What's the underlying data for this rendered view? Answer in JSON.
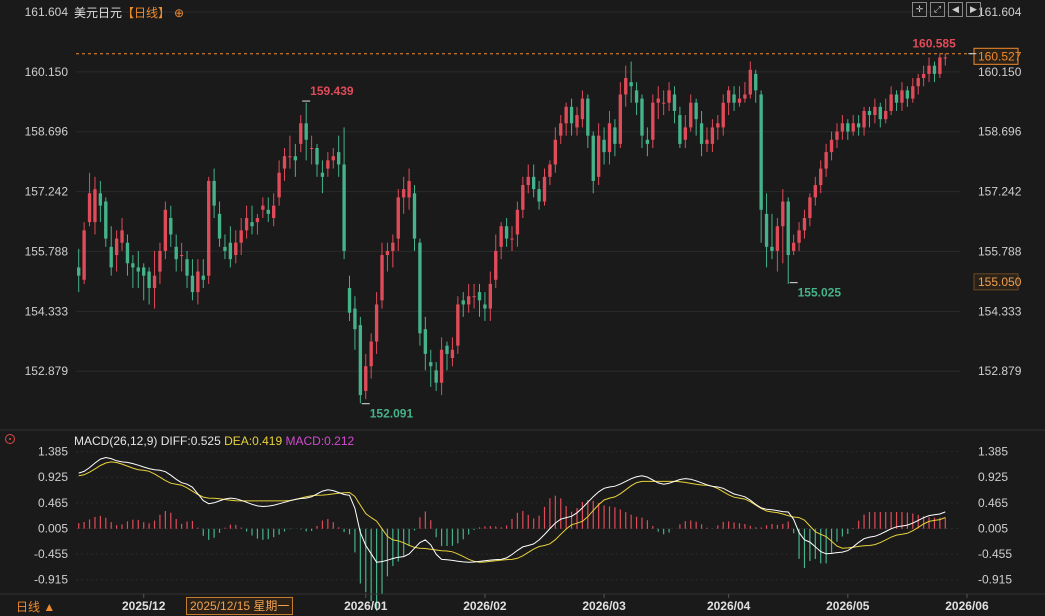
{
  "header": {
    "symbol": "美元日元",
    "timeframe": "【日线】",
    "add_icon": "plus-circle-icon",
    "tool_icons": [
      "crosshair-icon",
      "expand-icon",
      "prev-icon",
      "next-icon"
    ]
  },
  "macd_header": {
    "name": "MACD(26,12,9)",
    "diff": "DIFF:0.525",
    "dea": "DEA:0.419",
    "macd": "MACD:0.212"
  },
  "footer": {
    "period_label": "日线 ▲",
    "crosshair_date": "2025/12/15 星期一"
  },
  "colors": {
    "background": "#1a1a1a",
    "up": "#e04b5a",
    "down": "#45b28a",
    "dea": "#e8d23a",
    "diff": "#ffffff",
    "current_price": "#f08a2c"
  },
  "chart_data": [
    {
      "type": "candlestick",
      "ylim": [
        151.5,
        161.7
      ],
      "yticks": [
        "161.604",
        "160.150",
        "158.696",
        "157.242",
        "155.788",
        "154.333",
        "152.879"
      ],
      "xticks": [
        {
          "label": "2025/12",
          "index": 12
        },
        {
          "label": "2026/01",
          "index": 53
        },
        {
          "label": "2026/02",
          "index": 75
        },
        {
          "label": "2026/03",
          "index": 97
        },
        {
          "label": "2026/04",
          "index": 120
        },
        {
          "label": "2026/05",
          "index": 142
        },
        {
          "label": "2026/06",
          "index": 164
        }
      ],
      "annotations": [
        {
          "label": "159.439",
          "index": 42,
          "value": 159.44,
          "kind": "high"
        },
        {
          "label": "152.091",
          "index": 53,
          "value": 152.09,
          "kind": "low"
        },
        {
          "label": "155.025",
          "index": 132,
          "value": 155.03,
          "kind": "low"
        },
        {
          "label": "160.585",
          "index": 165,
          "value": 160.59,
          "kind": "high"
        }
      ],
      "current_price": {
        "label": "160.527",
        "value": 160.527
      },
      "crosshair_price": {
        "label": "155.050",
        "value": 155.05
      },
      "candles": [
        [
          155.4,
          155.2,
          155.85,
          154.8
        ],
        [
          155.1,
          156.3,
          156.5,
          155.0
        ],
        [
          156.5,
          157.2,
          157.7,
          156.4
        ],
        [
          156.5,
          157.3,
          157.6,
          156.2
        ],
        [
          157.2,
          156.9,
          157.5,
          156.5
        ],
        [
          157.0,
          156.1,
          157.1,
          155.9
        ],
        [
          155.9,
          155.4,
          156.4,
          155.2
        ],
        [
          155.7,
          156.1,
          156.3,
          155.3
        ],
        [
          156.0,
          156.3,
          156.6,
          155.8
        ],
        [
          156.0,
          155.5,
          156.2,
          155.2
        ],
        [
          155.5,
          155.4,
          155.7,
          154.9
        ],
        [
          155.4,
          155.3,
          155.8,
          154.9
        ],
        [
          155.4,
          155.2,
          155.5,
          154.6
        ],
        [
          155.3,
          154.9,
          155.4,
          154.5
        ],
        [
          154.9,
          155.2,
          155.8,
          154.4
        ],
        [
          155.3,
          155.8,
          156.0,
          155.0
        ],
        [
          155.8,
          156.8,
          157.0,
          155.6
        ],
        [
          156.6,
          156.2,
          156.9,
          155.9
        ],
        [
          155.9,
          155.6,
          156.2,
          155.3
        ],
        [
          155.7,
          155.7,
          156.0,
          155.3
        ],
        [
          155.6,
          155.2,
          155.8,
          154.9
        ],
        [
          155.2,
          154.8,
          155.6,
          154.6
        ],
        [
          154.8,
          155.3,
          155.6,
          154.5
        ],
        [
          155.2,
          155.1,
          155.6,
          154.9
        ],
        [
          155.2,
          157.5,
          157.6,
          155.0
        ],
        [
          157.5,
          156.9,
          157.8,
          156.6
        ],
        [
          156.7,
          156.1,
          157.0,
          155.9
        ],
        [
          155.9,
          155.8,
          156.2,
          155.6
        ],
        [
          156.0,
          155.6,
          156.4,
          155.4
        ],
        [
          155.7,
          156.0,
          156.3,
          155.5
        ],
        [
          156.0,
          156.3,
          156.6,
          155.7
        ],
        [
          156.3,
          156.6,
          156.9,
          156.1
        ],
        [
          156.5,
          156.4,
          156.9,
          156.2
        ],
        [
          156.5,
          156.6,
          156.7,
          156.2
        ],
        [
          156.8,
          156.9,
          157.1,
          156.6
        ],
        [
          156.8,
          156.7,
          157.1,
          156.5
        ],
        [
          156.6,
          156.9,
          157.2,
          156.4
        ],
        [
          157.1,
          157.7,
          158.0,
          156.9
        ],
        [
          157.8,
          158.1,
          158.3,
          157.5
        ],
        [
          158.1,
          158.1,
          158.6,
          157.8
        ],
        [
          158.1,
          158.0,
          158.4,
          157.6
        ],
        [
          158.4,
          158.9,
          159.1,
          158.2
        ],
        [
          158.9,
          158.5,
          159.4,
          158.0
        ],
        [
          158.3,
          158.3,
          158.6,
          157.9
        ],
        [
          158.3,
          157.9,
          158.4,
          157.6
        ],
        [
          157.7,
          157.6,
          158.0,
          157.2
        ],
        [
          157.8,
          158.0,
          158.2,
          157.6
        ],
        [
          158.0,
          158.1,
          158.3,
          157.8
        ],
        [
          158.2,
          157.9,
          158.6,
          157.6
        ],
        [
          157.9,
          155.8,
          158.8,
          155.6
        ],
        [
          154.9,
          154.3,
          155.2,
          154.1
        ],
        [
          154.4,
          153.9,
          154.7,
          153.4
        ],
        [
          154.0,
          152.3,
          154.2,
          152.1
        ],
        [
          152.4,
          153.0,
          153.3,
          152.2
        ],
        [
          153.0,
          153.6,
          153.8,
          152.7
        ],
        [
          153.6,
          154.5,
          154.8,
          153.3
        ],
        [
          154.6,
          155.7,
          156.0,
          154.4
        ],
        [
          155.7,
          155.8,
          156.0,
          155.3
        ],
        [
          155.8,
          156.0,
          156.2,
          155.4
        ],
        [
          156.1,
          157.1,
          157.3,
          155.8
        ],
        [
          157.1,
          157.3,
          157.6,
          156.7
        ],
        [
          157.1,
          157.5,
          157.8,
          156.8
        ],
        [
          157.2,
          156.1,
          157.4,
          155.8
        ],
        [
          156.0,
          153.8,
          156.1,
          153.5
        ],
        [
          153.9,
          153.3,
          154.2,
          152.9
        ],
        [
          153.1,
          153.0,
          153.4,
          152.5
        ],
        [
          152.9,
          152.6,
          153.1,
          152.4
        ],
        [
          152.6,
          153.4,
          153.7,
          152.3
        ],
        [
          153.5,
          153.3,
          153.6,
          152.9
        ],
        [
          153.2,
          153.4,
          153.7,
          153.0
        ],
        [
          153.5,
          154.5,
          154.7,
          153.3
        ],
        [
          154.6,
          154.5,
          154.8,
          154.2
        ],
        [
          154.5,
          154.7,
          155.0,
          154.3
        ],
        [
          154.7,
          154.7,
          155.0,
          154.4
        ],
        [
          154.8,
          154.6,
          155.0,
          154.2
        ],
        [
          154.5,
          154.4,
          154.8,
          154.1
        ],
        [
          154.4,
          155.0,
          155.3,
          154.1
        ],
        [
          155.1,
          155.8,
          156.2,
          154.9
        ],
        [
          155.9,
          156.4,
          156.5,
          155.6
        ],
        [
          156.4,
          156.1,
          156.6,
          155.9
        ],
        [
          156.1,
          156.1,
          156.4,
          155.8
        ],
        [
          156.2,
          156.8,
          157.0,
          155.9
        ],
        [
          156.8,
          157.4,
          157.6,
          156.6
        ],
        [
          157.4,
          157.6,
          157.9,
          157.2
        ],
        [
          157.6,
          157.3,
          157.9,
          157.1
        ],
        [
          157.3,
          157.0,
          157.5,
          156.8
        ],
        [
          157.0,
          157.6,
          157.8,
          156.9
        ],
        [
          157.6,
          157.9,
          158.0,
          157.4
        ],
        [
          157.9,
          158.5,
          158.8,
          157.7
        ],
        [
          158.6,
          158.9,
          159.1,
          158.4
        ],
        [
          158.9,
          159.3,
          159.4,
          158.6
        ],
        [
          159.3,
          158.9,
          159.5,
          158.6
        ],
        [
          158.8,
          159.1,
          159.3,
          158.6
        ],
        [
          159.0,
          159.5,
          159.7,
          158.8
        ],
        [
          159.5,
          158.6,
          159.6,
          158.3
        ],
        [
          158.6,
          157.5,
          158.7,
          157.2
        ],
        [
          157.6,
          158.6,
          158.9,
          157.4
        ],
        [
          158.5,
          158.2,
          158.8,
          157.9
        ],
        [
          158.2,
          158.9,
          159.2,
          157.9
        ],
        [
          158.8,
          158.4,
          159.0,
          158.1
        ],
        [
          158.4,
          159.6,
          159.9,
          158.3
        ],
        [
          159.6,
          160.0,
          160.3,
          159.3
        ],
        [
          159.9,
          159.8,
          160.4,
          159.4
        ],
        [
          159.7,
          159.4,
          159.9,
          159.1
        ],
        [
          159.5,
          158.6,
          159.6,
          158.3
        ],
        [
          158.5,
          158.4,
          158.8,
          158.1
        ],
        [
          158.5,
          159.4,
          159.6,
          158.3
        ],
        [
          159.4,
          159.5,
          159.8,
          159.0
        ],
        [
          159.4,
          159.4,
          159.7,
          159.1
        ],
        [
          159.4,
          159.7,
          159.9,
          159.2
        ],
        [
          159.6,
          159.2,
          159.8,
          158.9
        ],
        [
          159.1,
          158.4,
          159.3,
          158.3
        ],
        [
          158.5,
          158.8,
          159.1,
          158.3
        ],
        [
          158.8,
          159.4,
          159.6,
          158.7
        ],
        [
          159.4,
          159.0,
          159.5,
          158.6
        ],
        [
          158.9,
          158.4,
          159.2,
          158.1
        ],
        [
          158.4,
          158.5,
          158.8,
          158.2
        ],
        [
          158.4,
          158.8,
          159.0,
          158.2
        ],
        [
          158.8,
          158.9,
          159.1,
          158.5
        ],
        [
          158.8,
          159.4,
          159.6,
          158.6
        ],
        [
          159.4,
          159.7,
          159.8,
          159.1
        ],
        [
          159.6,
          159.4,
          159.8,
          159.2
        ],
        [
          159.4,
          159.5,
          159.8,
          159.3
        ],
        [
          159.5,
          159.6,
          159.9,
          159.4
        ],
        [
          159.6,
          160.2,
          160.4,
          159.5
        ],
        [
          160.1,
          159.7,
          160.2,
          159.4
        ],
        [
          159.6,
          156.8,
          159.7,
          156.0
        ],
        [
          156.7,
          155.9,
          157.2,
          155.4
        ],
        [
          155.9,
          155.8,
          156.7,
          155.6
        ],
        [
          155.8,
          156.4,
          156.6,
          155.3
        ],
        [
          156.4,
          157.0,
          157.3,
          155.5
        ],
        [
          157.0,
          155.7,
          157.1,
          155.0
        ],
        [
          155.8,
          156.0,
          156.2,
          155.7
        ],
        [
          156.0,
          156.3,
          156.5,
          155.8
        ],
        [
          156.3,
          156.6,
          156.8,
          156.1
        ],
        [
          156.6,
          157.1,
          157.2,
          156.4
        ],
        [
          157.1,
          157.4,
          157.6,
          156.9
        ],
        [
          157.4,
          157.8,
          158.0,
          157.2
        ],
        [
          157.8,
          158.2,
          158.4,
          157.6
        ],
        [
          158.2,
          158.5,
          158.7,
          158.0
        ],
        [
          158.5,
          158.7,
          158.9,
          158.3
        ],
        [
          158.7,
          158.9,
          159.1,
          158.5
        ],
        [
          158.9,
          158.7,
          159.0,
          158.5
        ],
        [
          158.7,
          158.9,
          159.1,
          158.6
        ],
        [
          158.9,
          158.8,
          159.1,
          158.6
        ],
        [
          158.8,
          159.2,
          159.3,
          158.6
        ],
        [
          159.2,
          159.1,
          159.3,
          158.8
        ],
        [
          159.1,
          159.3,
          159.5,
          158.9
        ],
        [
          159.3,
          159.0,
          159.4,
          158.8
        ],
        [
          159.0,
          159.2,
          159.5,
          158.9
        ],
        [
          159.2,
          159.6,
          159.8,
          159.1
        ],
        [
          159.6,
          159.4,
          159.7,
          159.2
        ],
        [
          159.4,
          159.7,
          159.9,
          159.2
        ],
        [
          159.7,
          159.5,
          159.8,
          159.3
        ],
        [
          159.5,
          159.8,
          160.0,
          159.4
        ],
        [
          159.8,
          160.0,
          160.1,
          159.6
        ],
        [
          160.0,
          160.1,
          160.3,
          159.8
        ],
        [
          160.1,
          160.3,
          160.5,
          159.9
        ],
        [
          160.3,
          160.1,
          160.4,
          159.9
        ],
        [
          160.1,
          160.5,
          160.6,
          160.0
        ],
        [
          160.5,
          160.5,
          160.6,
          160.3
        ]
      ]
    },
    {
      "type": "macd",
      "params": "MACD(26,12,9)",
      "ylim": [
        -1.1,
        1.45
      ],
      "yticks": [
        "1.385",
        "0.925",
        "0.465",
        "0.005",
        "-0.455",
        "-0.915"
      ],
      "diff_anchors": [
        [
          0,
          1.0
        ],
        [
          5,
          1.28
        ],
        [
          8,
          1.2
        ],
        [
          15,
          1.05
        ],
        [
          20,
          0.8
        ],
        [
          24,
          0.45
        ],
        [
          28,
          0.55
        ],
        [
          34,
          0.4
        ],
        [
          42,
          0.55
        ],
        [
          46,
          0.7
        ],
        [
          50,
          0.6
        ],
        [
          53,
          -0.3
        ],
        [
          55,
          -0.6
        ],
        [
          60,
          -0.5
        ],
        [
          64,
          -0.2
        ],
        [
          67,
          -0.55
        ],
        [
          72,
          -0.6
        ],
        [
          78,
          -0.55
        ],
        [
          83,
          -0.3
        ],
        [
          90,
          0.2
        ],
        [
          98,
          0.75
        ],
        [
          104,
          0.95
        ],
        [
          108,
          0.8
        ],
        [
          112,
          0.9
        ],
        [
          118,
          0.75
        ],
        [
          122,
          0.6
        ],
        [
          127,
          0.35
        ],
        [
          131,
          0.3
        ],
        [
          134,
          -0.2
        ],
        [
          138,
          -0.45
        ],
        [
          141,
          -0.42
        ],
        [
          146,
          -0.15
        ],
        [
          152,
          0.05
        ],
        [
          158,
          0.25
        ],
        [
          164,
          0.45
        ],
        [
          168,
          0.525
        ]
      ],
      "dea_anchors": [
        [
          0,
          0.95
        ],
        [
          6,
          1.2
        ],
        [
          12,
          1.05
        ],
        [
          18,
          0.8
        ],
        [
          24,
          0.55
        ],
        [
          30,
          0.5
        ],
        [
          38,
          0.5
        ],
        [
          44,
          0.6
        ],
        [
          50,
          0.65
        ],
        [
          54,
          0.2
        ],
        [
          58,
          -0.2
        ],
        [
          63,
          -0.35
        ],
        [
          68,
          -0.4
        ],
        [
          74,
          -0.6
        ],
        [
          80,
          -0.55
        ],
        [
          86,
          -0.3
        ],
        [
          92,
          0.1
        ],
        [
          98,
          0.55
        ],
        [
          104,
          0.85
        ],
        [
          110,
          0.85
        ],
        [
          116,
          0.78
        ],
        [
          122,
          0.55
        ],
        [
          128,
          0.3
        ],
        [
          133,
          0.2
        ],
        [
          137,
          -0.1
        ],
        [
          141,
          -0.35
        ],
        [
          146,
          -0.3
        ],
        [
          152,
          -0.1
        ],
        [
          158,
          0.15
        ],
        [
          164,
          0.35
        ],
        [
          168,
          0.419
        ]
      ]
    }
  ]
}
